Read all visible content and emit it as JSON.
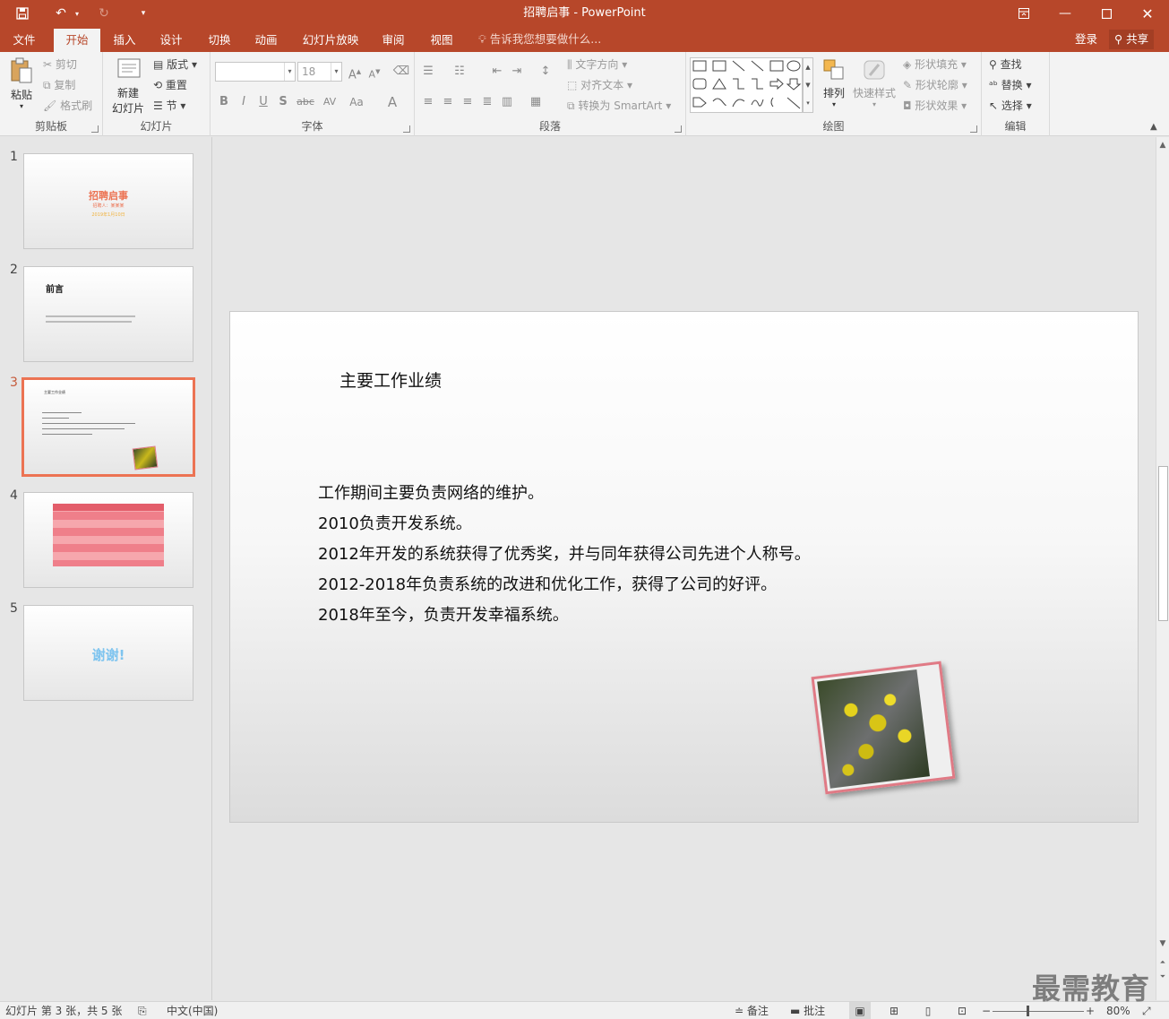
{
  "window": {
    "title": "招聘启事 - PowerPoint",
    "accent_color": "#b7472a"
  },
  "quick_access": {
    "save_icon": "save-icon",
    "undo_icon": "undo-icon",
    "redo_icon": "redo-icon",
    "customize_icon": "customize-icon"
  },
  "tabs": [
    "文件",
    "开始",
    "插入",
    "设计",
    "切换",
    "动画",
    "幻灯片放映",
    "审阅",
    "视图"
  ],
  "active_tab": "开始",
  "tell_me": "告诉我您想要做什么...",
  "account": {
    "login": "登录",
    "share": "共享"
  },
  "ribbon": {
    "clipboard": {
      "label": "剪贴板",
      "paste": "粘贴",
      "cut": "剪切",
      "copy": "复制",
      "format_painter": "格式刷"
    },
    "slides": {
      "label": "幻灯片",
      "new_slide_1": "新建",
      "new_slide_2": "幻灯片",
      "layout": "版式",
      "reset": "重置",
      "section": "节"
    },
    "font": {
      "label": "字体",
      "font_size": "18",
      "bold": "B",
      "italic": "I",
      "underline": "U",
      "shadow": "S",
      "strike": "abc",
      "spacing": "AV",
      "case": "Aa",
      "color": "A"
    },
    "paragraph": {
      "label": "段落",
      "text_direction": "文字方向",
      "align_text": "对齐文本",
      "smartart": "转换为 SmartArt"
    },
    "drawing": {
      "label": "绘图",
      "arrange": "排列",
      "quick_styles": "快速样式",
      "shape_fill": "形状填充",
      "shape_outline": "形状轮廓",
      "shape_effects": "形状效果"
    },
    "editing": {
      "label": "编辑",
      "find": "查找",
      "replace": "替换",
      "select": "选择"
    }
  },
  "thumbnails": [
    {
      "number": "1",
      "title": "招聘启事",
      "subtitle": "招聘人：某某某",
      "date": "2019年1月10日"
    },
    {
      "number": "2",
      "title": "前言"
    },
    {
      "number": "3",
      "title": "主要工作业绩"
    },
    {
      "number": "4",
      "title": ""
    },
    {
      "number": "5",
      "title": "谢谢!"
    }
  ],
  "active_slide": 3,
  "slide": {
    "title": "主要工作业绩",
    "lines": [
      "工作期间主要负责网络的维护。",
      "2010负责开发系统。",
      "2012年开发的系统获得了优秀奖，并与同年获得公司先进个人称号。",
      "2012-2018年负责系统的改进和优化工作，获得了公司的好评。",
      "2018年至今，负责开发幸福系统。"
    ]
  },
  "status_bar": {
    "slide_info": "幻灯片 第 3 张，共 5 张",
    "language": "中文(中国)",
    "notes": "备注",
    "comments": "批注",
    "zoom": "80%",
    "zoom_level": 0.8
  },
  "watermark": "最需教育"
}
